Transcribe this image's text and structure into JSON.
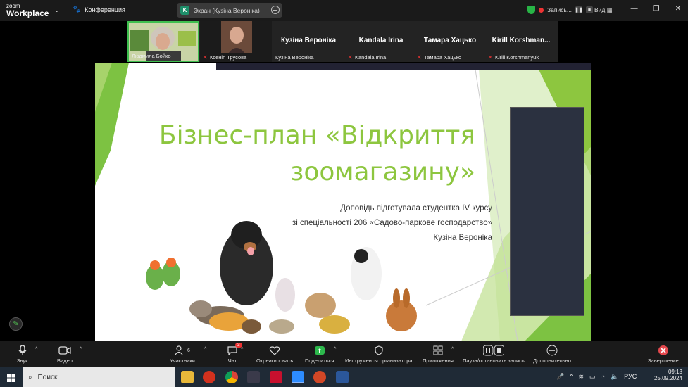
{
  "app": {
    "logo_top": "zoom",
    "logo_bottom": "Workplace",
    "conference_label": "Конференция"
  },
  "share_pill": {
    "letter": "K",
    "label": "Экран (Кузіна Вероніка)"
  },
  "recording": {
    "label": "Запись..."
  },
  "view_label": "Вид",
  "participants": [
    {
      "name": "Людмила Бойко",
      "muted": false
    },
    {
      "name": "Ксенія Трусова",
      "muted": true
    },
    {
      "big": "Кузіна Вероніка",
      "name": "Кузіна Вероніка",
      "muted": false
    },
    {
      "big": "Kandala Irina",
      "name": "Kandala Irina",
      "muted": true
    },
    {
      "big": "Тамара Хацько",
      "name": "Тамара Хацько",
      "muted": true
    },
    {
      "big": "Kirill  Korshman...",
      "name": "Kirill Korshmanyuk",
      "muted": true
    }
  ],
  "slide": {
    "title": "Бізнес-план «Відкриття зоомагазину»",
    "line1": "Доповідь підготувала студентка IV курсу",
    "line2": "зі спеціальності 206 «Садово-паркове господарство»",
    "line3": "Кузіна Вероніка"
  },
  "toolbar": {
    "audio": "Звук",
    "video": "Видео",
    "participants": "Участники",
    "participants_count": "6",
    "chat": "Чат",
    "chat_badge": "3",
    "react": "Отреагировать",
    "share": "Поделиться",
    "host_tools": "Инструменты организатора",
    "apps": "Приложения",
    "pause_rec": "Пауза/остановить запись",
    "more": "Дополнительно",
    "end": "Завершение"
  },
  "taskbar": {
    "search": "Поиск",
    "lang": "РУС",
    "time": "09:13",
    "date": "25.09.2024"
  },
  "colors": {
    "accent_green": "#8dc63f",
    "end_red": "#e5484d"
  }
}
